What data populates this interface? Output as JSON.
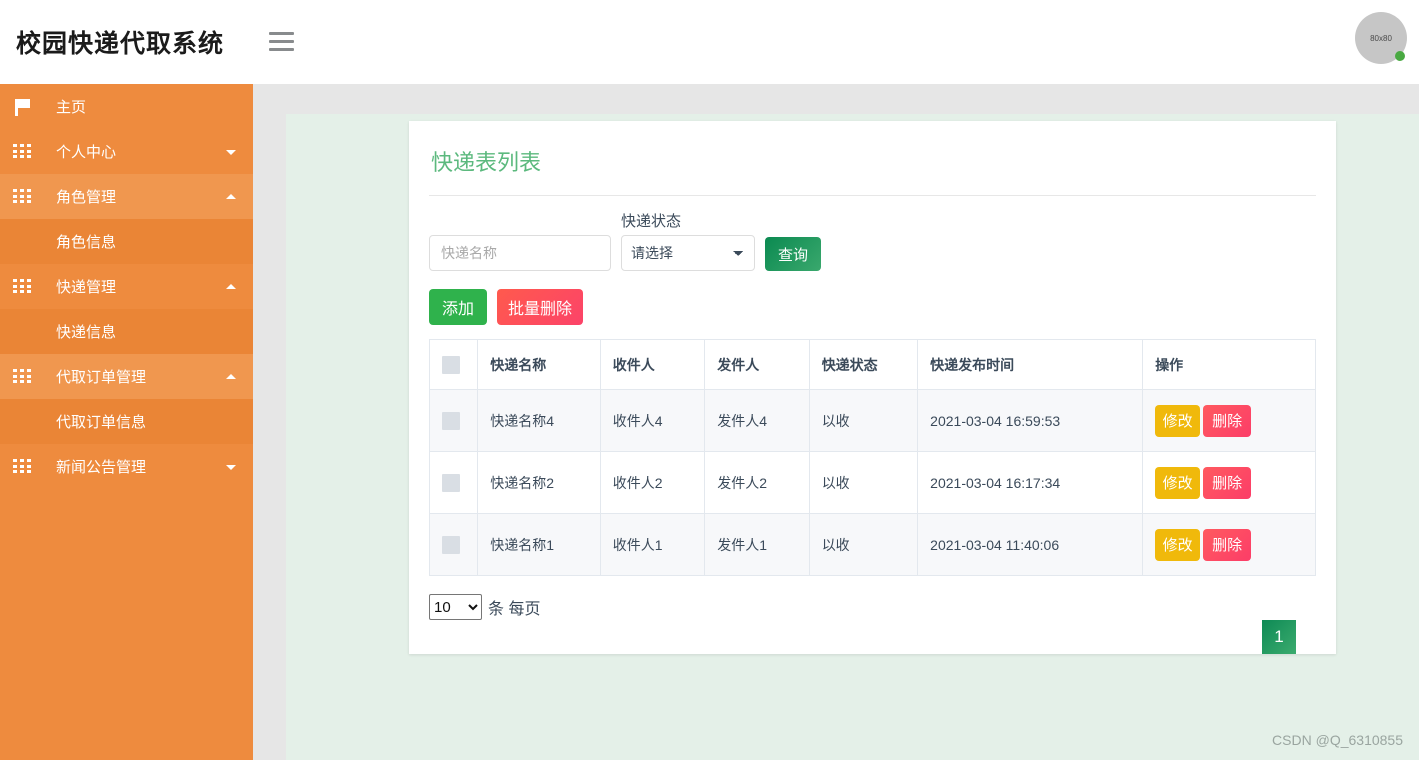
{
  "header": {
    "title": "校园快递代取系统",
    "menu_icon": "hamburger-icon",
    "avatar_text": "80x80"
  },
  "sidebar": {
    "items": [
      {
        "label": "主页",
        "icon": "flag-icon",
        "type": "link",
        "caret": "none",
        "state": "normal"
      },
      {
        "label": "个人中心",
        "icon": "grid-icon",
        "type": "group",
        "caret": "down",
        "state": "normal"
      },
      {
        "label": "角色管理",
        "icon": "grid-icon",
        "type": "group",
        "caret": "up",
        "state": "open"
      },
      {
        "label": "角色信息",
        "icon": "none",
        "type": "sub",
        "caret": "none",
        "state": "active"
      },
      {
        "label": "快递管理",
        "icon": "grid-icon",
        "type": "group",
        "caret": "up",
        "state": "normal"
      },
      {
        "label": "快递信息",
        "icon": "none",
        "type": "sub",
        "caret": "none",
        "state": "normal"
      },
      {
        "label": "代取订单管理",
        "icon": "grid-icon",
        "type": "group",
        "caret": "up",
        "state": "open"
      },
      {
        "label": "代取订单信息",
        "icon": "none",
        "type": "sub",
        "caret": "none",
        "state": "normal"
      },
      {
        "label": "新闻公告管理",
        "icon": "grid-icon",
        "type": "group",
        "caret": "down",
        "state": "normal"
      }
    ]
  },
  "card": {
    "title": "快递表列表",
    "search": {
      "name_placeholder": "快递名称",
      "name_value": "",
      "status_label": "快递状态",
      "status_selected": "请选择",
      "status_options": [
        "请选择"
      ],
      "query_label": "查询"
    },
    "actions": {
      "add_label": "添加",
      "batch_delete_label": "批量删除"
    },
    "table": {
      "columns": [
        "",
        "快递名称",
        "收件人",
        "发件人",
        "快递状态",
        "快递发布时间",
        "操作"
      ],
      "rows": [
        {
          "name": "快递名称4",
          "receiver": "收件人4",
          "sender": "发件人4",
          "status": "以收",
          "time": "2021-03-04 16:59:53",
          "edit_label": "修改",
          "delete_label": "删除"
        },
        {
          "name": "快递名称2",
          "receiver": "收件人2",
          "sender": "发件人2",
          "status": "以收",
          "time": "2021-03-04 16:17:34",
          "edit_label": "修改",
          "delete_label": "删除"
        },
        {
          "name": "快递名称1",
          "receiver": "收件人1",
          "sender": "发件人1",
          "status": "以收",
          "time": "2021-03-04 11:40:06",
          "edit_label": "修改",
          "delete_label": "删除"
        }
      ]
    },
    "pagination": {
      "page_size": "10",
      "page_size_options": [
        "10"
      ],
      "per_page_text": "条 每页",
      "current_page": "1"
    }
  },
  "watermark": "CSDN @Q_6310855",
  "colors": {
    "sidebar": "#EE8B3E",
    "sidebar_open": "#F0974F",
    "sidebar_sub": "#EA8536",
    "accent_green": "#5CB97E",
    "content_bg": "#E4F0E8",
    "gutter_bg": "#E6E6E6",
    "edit_yellow": "#F0B90B",
    "delete_red": "#FC3D68",
    "add_green": "#2FB24C"
  }
}
